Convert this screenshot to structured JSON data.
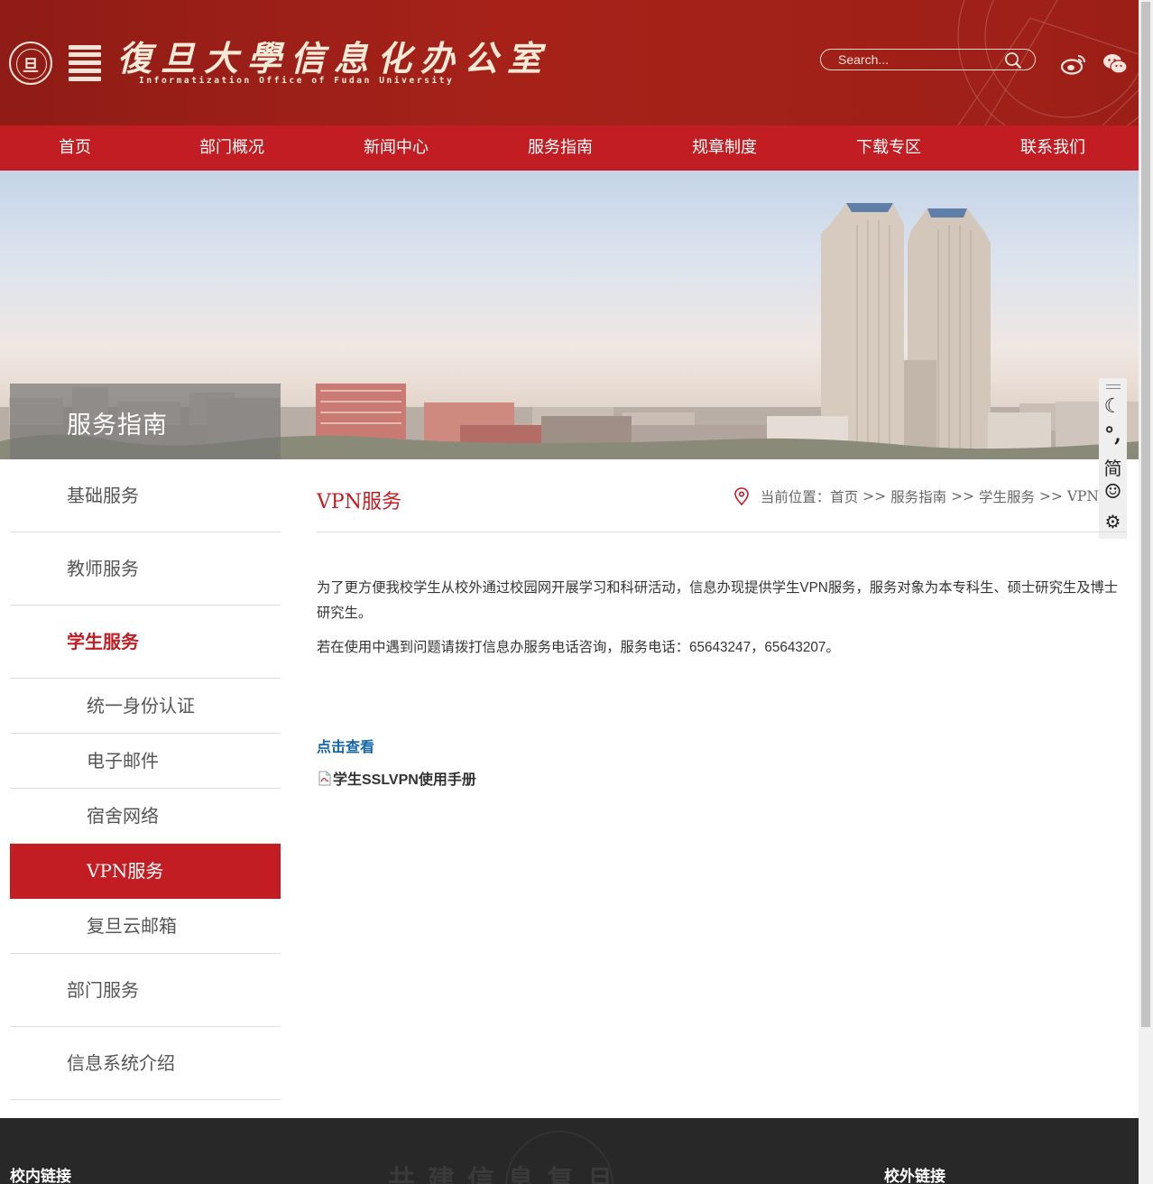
{
  "header": {
    "logo_seal_char": "旦",
    "logo_cn": "復旦大學信息化办公室",
    "logo_en": "Informatization Office of Fudan University",
    "search_placeholder": "Search..."
  },
  "icons": {
    "search": "search-icon",
    "weibo": "weibo-icon",
    "wechat": "wechat-icon",
    "location": "location-pin-icon",
    "pdf": "pdf-file-icon"
  },
  "nav": [
    "首页",
    "部门概况",
    "新闻中心",
    "服务指南",
    "规章制度",
    "下载专区",
    "联系我们"
  ],
  "banner": {
    "title": "服务指南"
  },
  "float_toolbar": {
    "items": [
      "☾",
      "°,",
      "简",
      "☺",
      "⚙"
    ]
  },
  "sidebar": {
    "items": [
      {
        "label": "基础服务"
      },
      {
        "label": "教师服务"
      },
      {
        "label": "学生服务"
      }
    ],
    "sub_items": [
      "统一身份认证",
      "电子邮件",
      "宿舍网络",
      "VPN服务",
      "复旦云邮箱"
    ],
    "bottom_items": [
      "部门服务",
      "信息系统介绍"
    ]
  },
  "content": {
    "title": "VPN服务",
    "breadcrumb_label": "当前位置：",
    "breadcrumb": [
      "首页",
      "服务指南",
      "学生服务",
      "VPN"
    ],
    "breadcrumb_sep": " >> ",
    "paragraph1": "为了更方便我校学生从校外通过校园网开展学习和科研活动，信息办现提供学生VPN服务，服务对象为本专科生、硕士研究生及博士研究生。",
    "paragraph2": "若在使用中遇到问题请拨打信息办服务电话咨询，服务电话：65643247，65643207。",
    "view_link": "点击查看",
    "file_link": "学生SSLVPN使用手册"
  },
  "footer": {
    "motto": "共建信息复旦",
    "internal_links": "校内链接",
    "external_links": "校外链接"
  },
  "colors": {
    "brand_red": "#c11d22",
    "header_red": "#a62219",
    "link_blue": "#1565a8",
    "footer_bg": "#282828"
  }
}
